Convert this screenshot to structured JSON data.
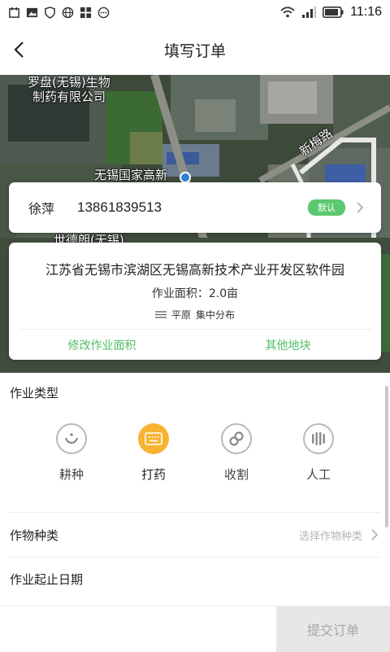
{
  "status_bar": {
    "time": "11:16"
  },
  "nav": {
    "title": "填写订单"
  },
  "map_labels": {
    "company_line1": "罗盘(无锡)生物",
    "company_line2": "制药有限公司",
    "road": "新梅路",
    "district": "无锡国家高新",
    "partial": "世德朗(无锡)"
  },
  "contact": {
    "name": "徐萍",
    "phone": "13861839513",
    "badge": "默认"
  },
  "address": {
    "full": "江苏省无锡市滨湖区无锡高新技术产业开发区软件园",
    "area": "作业面积：2.0亩",
    "terrain": "平原",
    "distribution": "集中分布",
    "modify_label": "修改作业面积",
    "other_label": "其他地块"
  },
  "form": {
    "op_type_label": "作业类型",
    "op_types": [
      {
        "label": "耕种",
        "icon": "smile-icon"
      },
      {
        "label": "打药",
        "icon": "keyboard-icon"
      },
      {
        "label": "收割",
        "icon": "link-icon"
      },
      {
        "label": "人工",
        "icon": "dots-icon"
      }
    ],
    "selected_op": "打药",
    "crop_label": "作物种类",
    "crop_placeholder": "选择作物种类",
    "date_label": "作业起止日期"
  },
  "submit": {
    "label": "提交订单"
  },
  "colors": {
    "accent_green": "#4fbf66",
    "badge_green": "#5cc86f",
    "selected_orange": "#f7b432"
  }
}
